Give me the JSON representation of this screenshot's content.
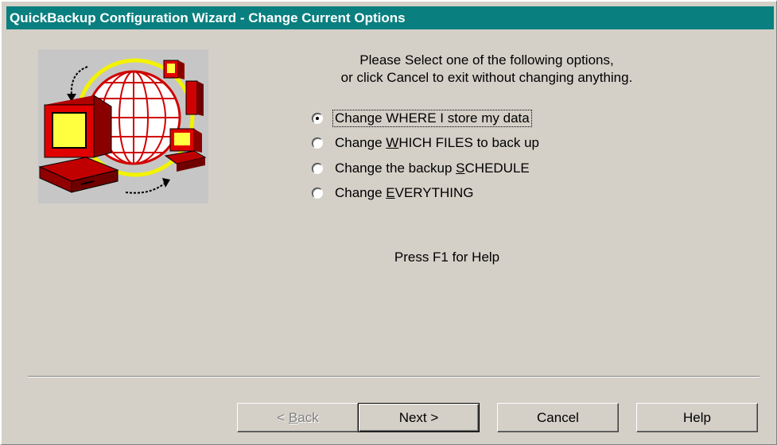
{
  "window": {
    "title": "QuickBackup Configuration Wizard - Change Current Options"
  },
  "illustration": {
    "icon": "network-computers-globe-icon"
  },
  "prompt": {
    "line1": "Please Select one of the following options,",
    "line2": "or click Cancel to exit without changing anything."
  },
  "options": [
    {
      "pre": "Change WHERE I store my data",
      "mnemonic": "",
      "post": "",
      "selected": true
    },
    {
      "pre": "Change ",
      "mnemonic": "W",
      "post": "HICH FILES to back up",
      "selected": false
    },
    {
      "pre": "Change the backup ",
      "mnemonic": "S",
      "post": "CHEDULE",
      "selected": false
    },
    {
      "pre": "Change ",
      "mnemonic": "E",
      "post": "VERYTHING",
      "selected": false
    }
  ],
  "help_hint": "Press F1 for Help",
  "buttons": {
    "back": {
      "pre": "< ",
      "mnemonic": "B",
      "post": "ack",
      "enabled": false
    },
    "next": "Next >",
    "cancel": "Cancel",
    "help": "Help"
  },
  "colors": {
    "titlebar": "#0a7f7f",
    "dialog_bg": "#d4d0c8"
  }
}
